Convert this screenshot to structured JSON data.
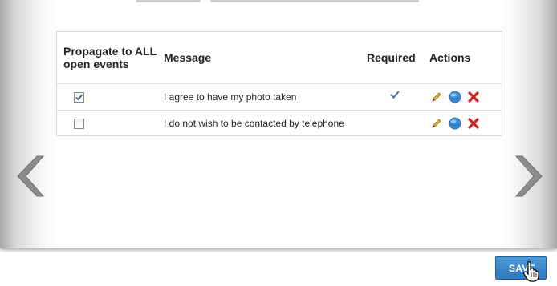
{
  "table": {
    "headers": {
      "propagate": "Propagate to ALL open events",
      "message": "Message",
      "required": "Required",
      "actions": "Actions"
    },
    "rows": [
      {
        "propagate_checked": true,
        "message": "I agree to have my photo taken",
        "required": true
      },
      {
        "propagate_checked": false,
        "message": "I do not wish to be contacted by telephone",
        "required": false
      }
    ]
  },
  "icons": {
    "edit": "pencil-icon",
    "view": "globe-icon",
    "delete": "delete-x-icon",
    "prev": "chevron-left-icon",
    "next": "chevron-right-icon"
  },
  "buttons": {
    "save": "SAVE"
  },
  "colors": {
    "save_button": "#3a86c8",
    "check": "#4a6fa5",
    "delete": "#d42020",
    "arrow": "#8c8c8c"
  }
}
